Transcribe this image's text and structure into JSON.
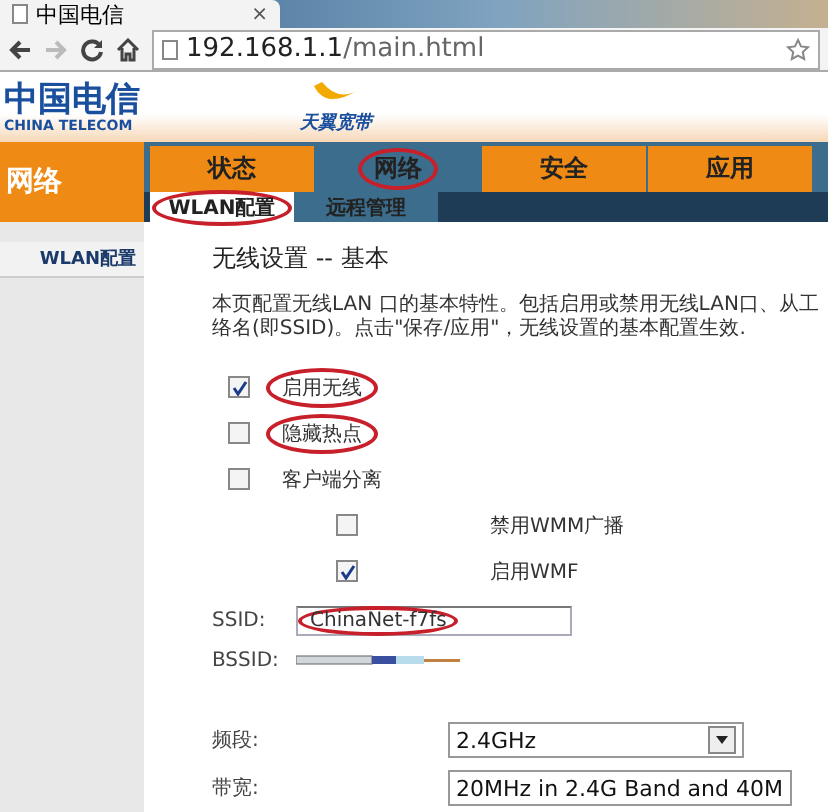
{
  "browser": {
    "tab_title": "中国电信",
    "tab_close": "×",
    "url_host": "192.168.1.1",
    "url_path": "/main.html"
  },
  "header": {
    "logo_cn": "中国电信",
    "logo_en": "CHINA TELECOM",
    "brand": "天翼宽带"
  },
  "section_title": "网络",
  "main_tabs": [
    {
      "label": "状态",
      "selected": false,
      "circled": false
    },
    {
      "label": "网络",
      "selected": true,
      "circled": true
    },
    {
      "label": "安全",
      "selected": false,
      "circled": false
    },
    {
      "label": "应用",
      "selected": false,
      "circled": false
    }
  ],
  "sub_tabs": [
    {
      "label": "WLAN配置",
      "selected": true,
      "circled": true
    },
    {
      "label": "远程管理",
      "selected": false,
      "circled": false
    }
  ],
  "sidebar": {
    "items": [
      {
        "label": "WLAN配置",
        "selected": true
      }
    ]
  },
  "content": {
    "title": "无线设置 -- 基本",
    "description": [
      "本页配置无线LAN 口的基本特性。包括启用或禁用无线LAN口、从工",
      "络名(即SSID)。点击\"保存/应用\"，无线设置的基本配置生效."
    ],
    "options": [
      {
        "kind": "main",
        "label": "启用无线",
        "checked": true,
        "circled": true
      },
      {
        "kind": "main",
        "label": "隐藏热点",
        "checked": false,
        "circled": true
      },
      {
        "kind": "main",
        "label": "客户端分离",
        "checked": false,
        "circled": false
      },
      {
        "kind": "sub",
        "label": "禁用WMM广播",
        "checked": false,
        "circled": false
      },
      {
        "kind": "sub",
        "label": "启用WMF",
        "checked": true,
        "circled": false
      }
    ],
    "ssid": {
      "label": "SSID:",
      "value": "ChinaNet-f7fs",
      "circled": true
    },
    "bssid": {
      "label": "BSSID:"
    },
    "band": {
      "label": "频段:",
      "value": "2.4GHz"
    },
    "bandwidth": {
      "label": "带宽:",
      "value": "20MHz in 2.4G Band and 40M"
    }
  }
}
